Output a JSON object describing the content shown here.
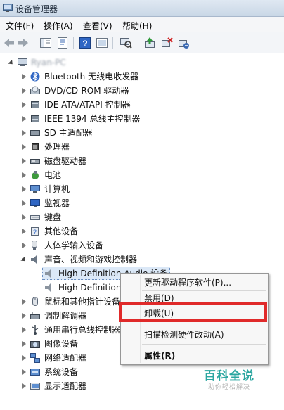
{
  "window": {
    "title": "设备管理器"
  },
  "menu": [
    "文件(F)",
    "操作(A)",
    "查看(V)",
    "帮助(H)"
  ],
  "toolbar": {
    "icons": [
      "back-arrow-icon",
      "forward-arrow-icon",
      "show-hide-tree-icon",
      "properties-icon",
      "help-icon",
      "console-icon",
      "scan-hardware-icon",
      "update-driver-icon",
      "disable-device-icon",
      "uninstall-device-icon"
    ]
  },
  "tree": {
    "root": "Ryan-PC",
    "categories": [
      {
        "label": "Bluetooth 无线电收发器",
        "icon": "bluetooth-radio-icon"
      },
      {
        "label": "DVD/CD-ROM 驱动器",
        "icon": "dvd-drive-icon"
      },
      {
        "label": "IDE ATA/ATAPI 控制器",
        "icon": "ide-controller-icon"
      },
      {
        "label": "IEEE 1394 总线主控制器",
        "icon": "ieee1394-controller-icon"
      },
      {
        "label": "SD 主适配器",
        "icon": "sd-adapter-icon"
      },
      {
        "label": "处理器",
        "icon": "processor-icon"
      },
      {
        "label": "磁盘驱动器",
        "icon": "disk-drive-icon"
      },
      {
        "label": "电池",
        "icon": "battery-icon"
      },
      {
        "label": "计算机",
        "icon": "computer-icon"
      },
      {
        "label": "监视器",
        "icon": "monitor-icon"
      },
      {
        "label": "键盘",
        "icon": "keyboard-icon"
      },
      {
        "label": "其他设备",
        "icon": "other-devices-icon"
      },
      {
        "label": "人体学输入设备",
        "icon": "hid-icon"
      },
      {
        "label": "声音、视频和游戏控制器",
        "icon": "sound-controller-icon",
        "expanded": true
      },
      {
        "label": "鼠标和其他指针设备",
        "icon": "mouse-icon"
      },
      {
        "label": "调制解调器",
        "icon": "modem-icon"
      },
      {
        "label": "通用串行总线控制器",
        "icon": "usb-controller-icon"
      },
      {
        "label": "图像设备",
        "icon": "imaging-device-icon"
      },
      {
        "label": "网络适配器",
        "icon": "network-adapter-icon"
      },
      {
        "label": "系统设备",
        "icon": "system-devices-icon"
      },
      {
        "label": "显示适配器",
        "icon": "display-adapter-icon"
      }
    ],
    "sound_children": [
      {
        "label": "High Definition Audio 设备",
        "selected": true
      },
      {
        "label": "High Definition"
      }
    ]
  },
  "context_menu": {
    "update_driver": "更新驱动程序软件(P)...",
    "disable": "禁用(D)",
    "uninstall": "卸载(U)",
    "scan": "扫描检测硬件改动(A)",
    "properties": "属性(R)"
  },
  "watermark": {
    "main": "百科全说",
    "sub": "助你轻松解决"
  },
  "colors": {
    "highlight_box": "#e02a2a",
    "watermark": "#2aa6a0",
    "selection_bg": "#dbe8f7"
  }
}
